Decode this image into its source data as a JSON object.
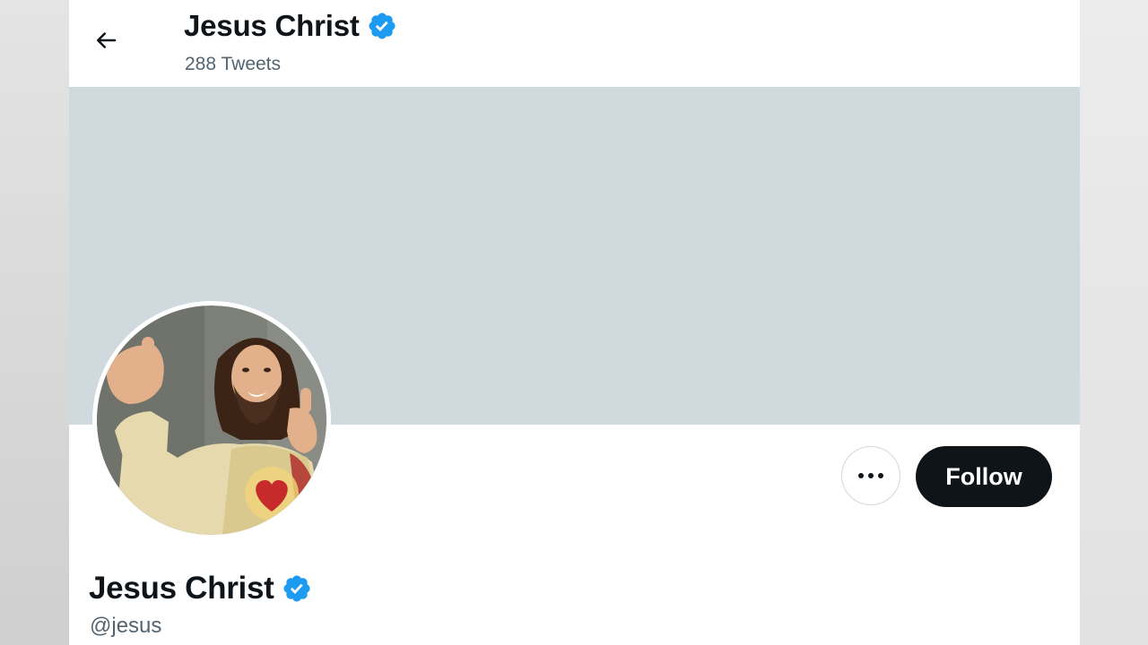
{
  "header": {
    "name": "Jesus Christ",
    "tweet_count": "288 Tweets",
    "back_icon": "arrow-left-icon",
    "verified_icon": "verified-badge-icon"
  },
  "profile": {
    "name": "Jesus Christ",
    "handle": "@jesus",
    "verified_icon": "verified-badge-icon",
    "avatar": "avatar-image"
  },
  "actions": {
    "more_icon": "more-horizontal-icon",
    "follow_label": "Follow"
  },
  "colors": {
    "text_primary": "#0f1419",
    "text_secondary": "#536471",
    "verified_blue": "#1d9bf0",
    "banner": "#cfd9de",
    "follow_bg": "#0f1419"
  }
}
